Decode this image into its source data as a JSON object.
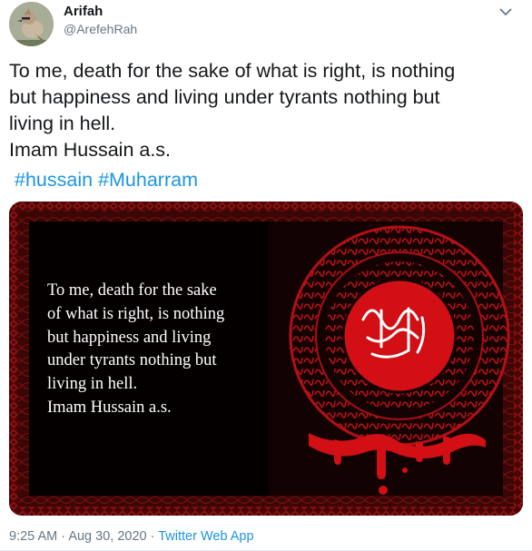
{
  "user": {
    "display_name": "Arifah",
    "handle": "@ArefehRah",
    "avatar_icon": "bird-avatar"
  },
  "tweet": {
    "text": "To me, death for the sake of what is right, is nothing\nbut happiness and living under tyrants nothing but\nliving in hell.\nImam Hussain a.s.",
    "hashtags": [
      "#hussain",
      "#Muharram"
    ]
  },
  "media": {
    "quote": "To me, death for the sake\nof what is right, is nothing\nbut happiness and living\nunder tyrants nothing but\nliving in hell.\nImam Hussain a.s."
  },
  "footer": {
    "time": "9:25 AM",
    "separator": "·",
    "date": "Aug 30, 2020",
    "source": "Twitter Web App"
  },
  "colors": {
    "link": "#1b95e0",
    "frame_red": "#7a0a0a",
    "seal_red": "#d10f14"
  }
}
